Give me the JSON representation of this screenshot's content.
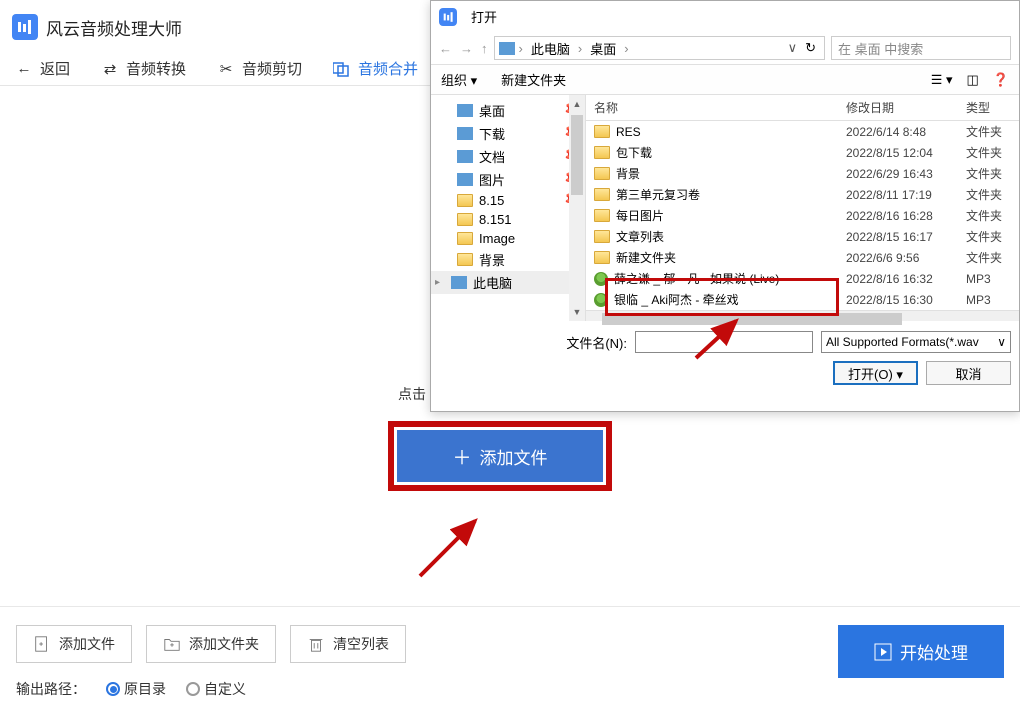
{
  "app": {
    "title": "风云音频处理大师"
  },
  "tabs": {
    "back": "返回",
    "convert": "音频转换",
    "cut": "音频剪切",
    "merge": "音频合并"
  },
  "main": {
    "hint": "点击",
    "add_file": "添加文件"
  },
  "bottom": {
    "add_file": "添加文件",
    "add_folder": "添加文件夹",
    "clear": "清空列表",
    "start": "开始处理",
    "output_label": "输出路径：",
    "radio1": "原目录",
    "radio2": "自定义"
  },
  "dialog": {
    "title": "打开",
    "path_seg1": "此电脑",
    "path_seg2": "桌面",
    "search_placeholder": "在 桌面 中搜索",
    "toolbar": {
      "organize": "组织",
      "new_folder": "新建文件夹"
    },
    "sidebar": [
      {
        "label": "桌面",
        "type": "special",
        "pin": true
      },
      {
        "label": "下载",
        "type": "special",
        "pin": true
      },
      {
        "label": "文档",
        "type": "special",
        "pin": true
      },
      {
        "label": "图片",
        "type": "special",
        "pin": true
      },
      {
        "label": "8.15",
        "type": "folder",
        "pin": true
      },
      {
        "label": "8.151",
        "type": "folder"
      },
      {
        "label": "Image",
        "type": "folder"
      },
      {
        "label": "背景",
        "type": "folder"
      },
      {
        "label": "此电脑",
        "type": "pc"
      }
    ],
    "columns": {
      "name": "名称",
      "date": "修改日期",
      "type": "类型"
    },
    "files": [
      {
        "name": "RES",
        "date": "2022/6/14 8:48",
        "type": "文件夹",
        "kind": "folder"
      },
      {
        "name": "包下载",
        "date": "2022/8/15 12:04",
        "type": "文件夹",
        "kind": "folder"
      },
      {
        "name": "背景",
        "date": "2022/6/29 16:43",
        "type": "文件夹",
        "kind": "folder"
      },
      {
        "name": "第三单元复习卷",
        "date": "2022/8/11 17:19",
        "type": "文件夹",
        "kind": "folder"
      },
      {
        "name": "每日图片",
        "date": "2022/8/16 16:28",
        "type": "文件夹",
        "kind": "folder"
      },
      {
        "name": "文章列表",
        "date": "2022/8/15 16:17",
        "type": "文件夹",
        "kind": "folder"
      },
      {
        "name": "新建文件夹",
        "date": "2022/6/6 9:56",
        "type": "文件夹",
        "kind": "folder"
      },
      {
        "name": "薛之谦 _ 郁一凡 - 如果说 (Live)",
        "date": "2022/8/16 16:32",
        "type": "MP3",
        "kind": "media"
      },
      {
        "name": "银临 _ Aki阿杰 - 牵丝戏",
        "date": "2022/8/15 16:30",
        "type": "MP3",
        "kind": "media"
      }
    ],
    "filename_label": "文件名(N):",
    "filter": "All Supported Formats(*.wav",
    "open_btn": "打开(O)",
    "cancel_btn": "取消"
  }
}
